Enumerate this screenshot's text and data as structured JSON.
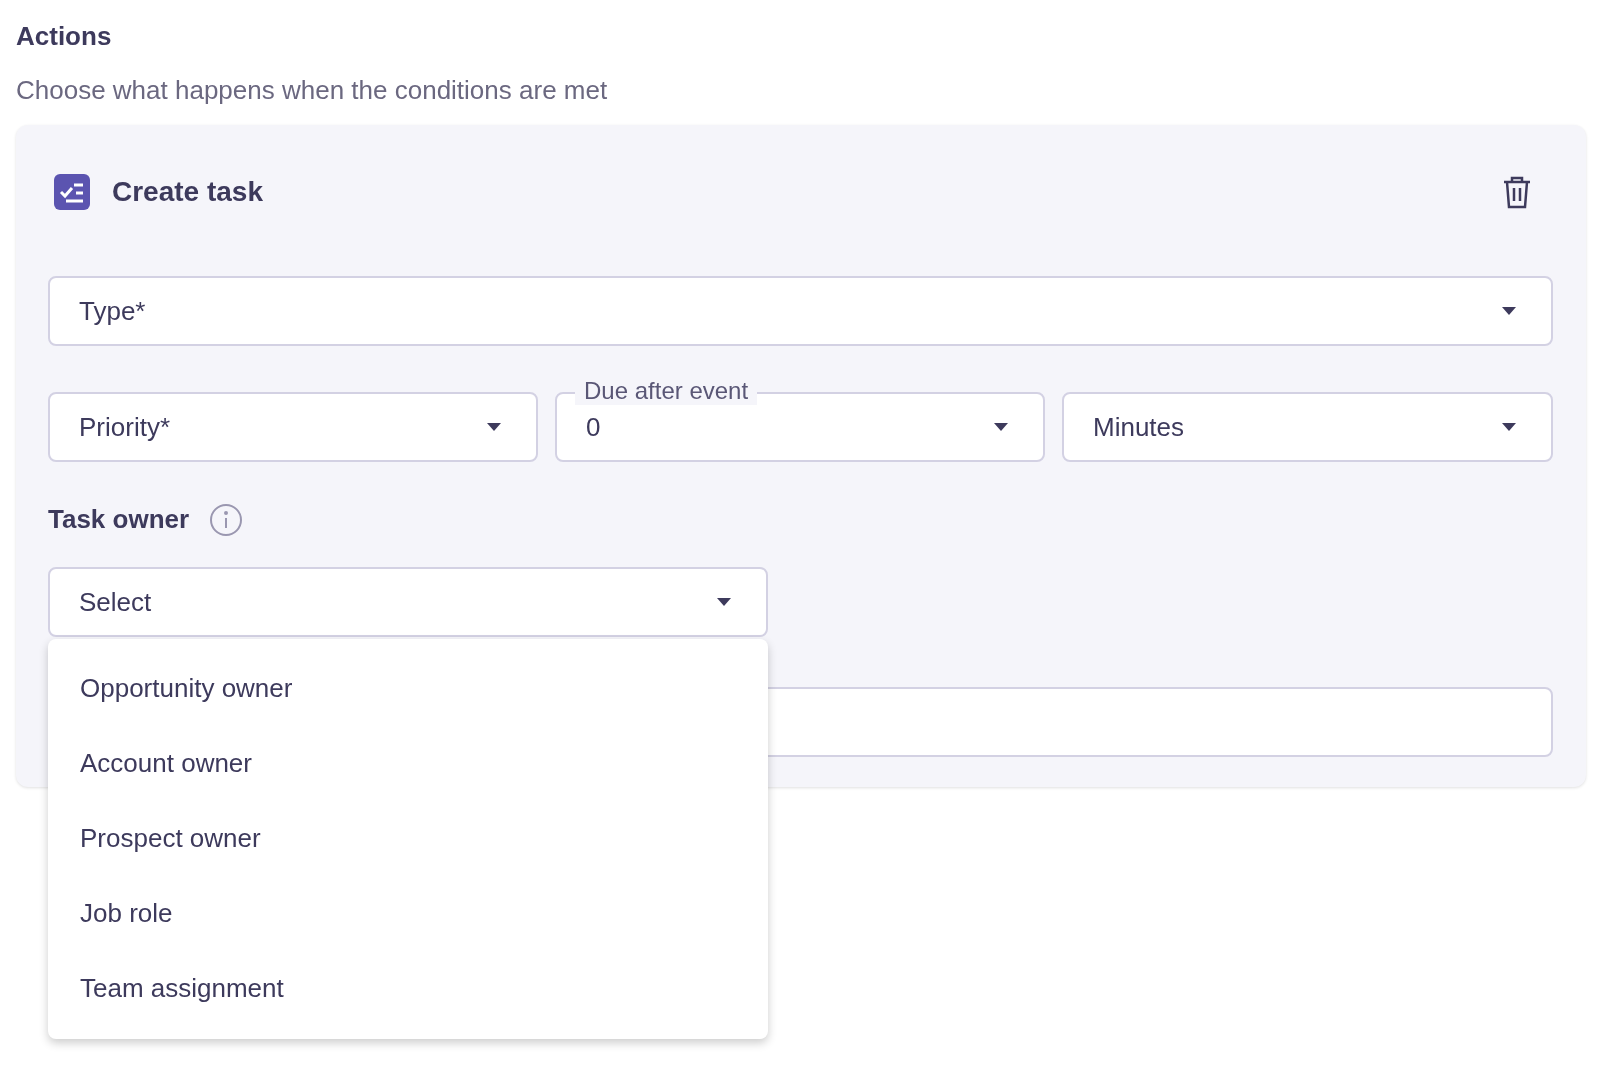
{
  "header": {
    "title": "Actions",
    "subtitle": "Choose what happens when the conditions are met"
  },
  "action": {
    "title": "Create task",
    "type_field": {
      "placeholder": "Type*"
    },
    "priority_field": {
      "placeholder": "Priority*"
    },
    "due_field": {
      "label": "Due after event",
      "value": "0"
    },
    "unit_field": {
      "value": "Minutes"
    },
    "owner": {
      "label": "Task owner",
      "placeholder": "Select",
      "expanded": true,
      "options": [
        {
          "label": "Opportunity owner"
        },
        {
          "label": "Account owner"
        },
        {
          "label": "Prospect owner"
        },
        {
          "label": "Job role"
        },
        {
          "label": "Team assignment"
        }
      ]
    }
  }
}
